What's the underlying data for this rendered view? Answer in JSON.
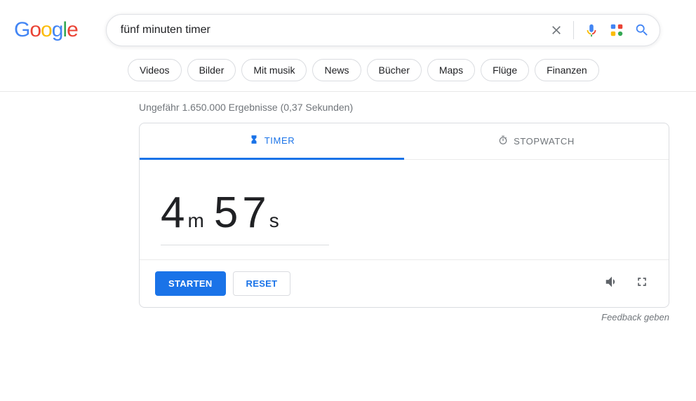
{
  "header": {
    "logo_chars": [
      "G",
      "o",
      "o",
      "g",
      "l",
      "e"
    ],
    "search_value": "fünf minuten timer"
  },
  "chips": [
    "Videos",
    "Bilder",
    "Mit musik",
    "News",
    "Bücher",
    "Maps",
    "Flüge",
    "Finanzen"
  ],
  "stats": "Ungefähr 1.650.000 Ergebnisse (0,37 Sekunden)",
  "widget": {
    "tab_timer": "TIMER",
    "tab_stopwatch": "STOPWATCH",
    "minutes": "4",
    "minutes_unit": "m",
    "seconds": "57",
    "seconds_unit": "s",
    "start_label": "STARTEN",
    "reset_label": "RESET"
  },
  "feedback": "Feedback geben"
}
